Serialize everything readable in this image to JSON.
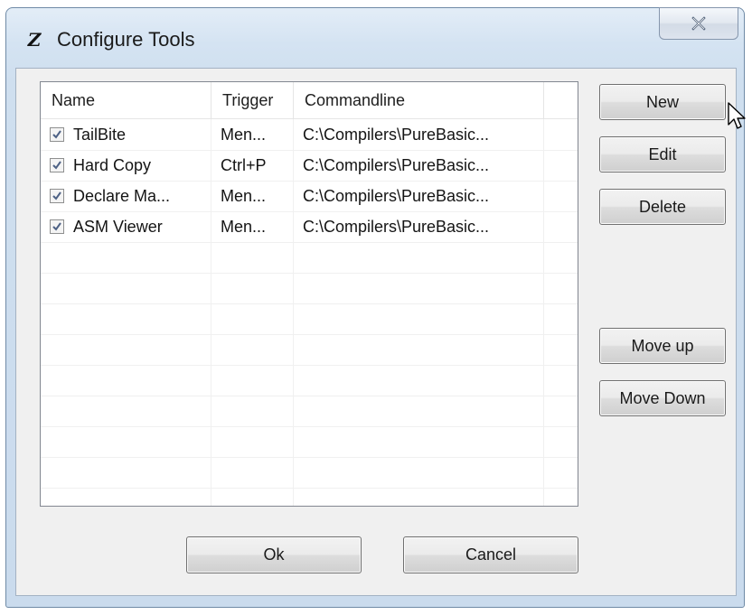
{
  "window": {
    "title": "Configure Tools",
    "icon": "pb-z-icon",
    "close_icon": "close-x-icon"
  },
  "list": {
    "columns": [
      "Name",
      "Trigger",
      "Commandline",
      ""
    ],
    "rows": [
      {
        "checked": true,
        "name": "TailBite",
        "trigger": "Men...",
        "commandline": "C:\\Compilers\\PureBasic..."
      },
      {
        "checked": true,
        "name": "Hard Copy",
        "trigger": "Ctrl+P",
        "commandline": "C:\\Compilers\\PureBasic..."
      },
      {
        "checked": true,
        "name": "Declare Ma...",
        "trigger": "Men...",
        "commandline": "C:\\Compilers\\PureBasic..."
      },
      {
        "checked": true,
        "name": "ASM Viewer",
        "trigger": "Men...",
        "commandline": "C:\\Compilers\\PureBasic..."
      }
    ]
  },
  "buttons": {
    "new": "New",
    "edit": "Edit",
    "delete": "Delete",
    "move_up": "Move up",
    "move_down": "Move Down",
    "ok": "Ok",
    "cancel": "Cancel"
  }
}
